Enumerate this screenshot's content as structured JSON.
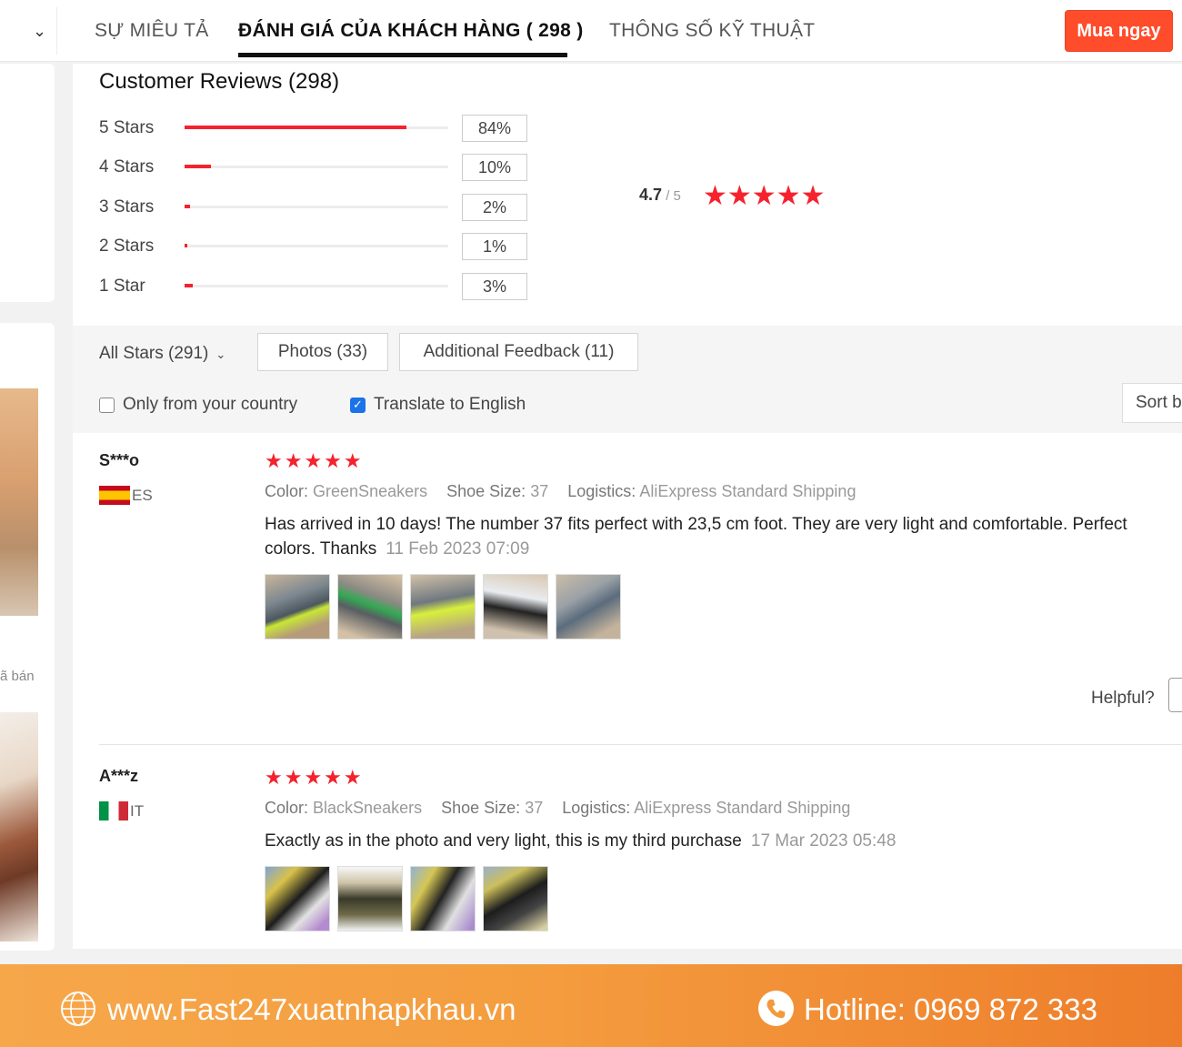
{
  "tabs": [
    {
      "label": "SỰ MIÊU TẢ"
    },
    {
      "label": "ĐÁNH GIÁ CỦA KHÁCH HÀNG  ( 298 )"
    },
    {
      "label": "THÔNG SỐ KỸ THUẬT"
    }
  ],
  "buy_button": "Mua ngay",
  "sidebar": {
    "sold_text": "ã bán"
  },
  "reviews": {
    "title": "Customer Reviews (298)",
    "breakdown": [
      {
        "label": "5 Stars",
        "percent": 84,
        "percent_text": "84%"
      },
      {
        "label": "4 Stars",
        "percent": 10,
        "percent_text": "10%"
      },
      {
        "label": "3 Stars",
        "percent": 2,
        "percent_text": "2%"
      },
      {
        "label": "2 Stars",
        "percent": 1,
        "percent_text": "1%"
      },
      {
        "label": "1 Star",
        "percent": 3,
        "percent_text": "3%"
      }
    ],
    "average": "4.7",
    "average_suffix": " / 5",
    "average_stars": "★★★★★"
  },
  "filters": {
    "all_stars": "All Stars (291)",
    "photos": "Photos (33)",
    "additional": "Additional Feedback (11)",
    "only_country": "Only from your country",
    "only_country_checked": false,
    "translate": "Translate to English",
    "translate_checked": true,
    "sort": "Sort b"
  },
  "review_items": [
    {
      "name": "S***o",
      "country": "ES",
      "stars": "★★★★★",
      "color_label": "Color:",
      "color_value": "GreenSneakers",
      "size_label": "Shoe Size:",
      "size_value": "37",
      "logistics_label": "Logistics:",
      "logistics_value": "AliExpress Standard Shipping",
      "text": "Has arrived in 10 days! The number 37 fits perfect with 23,5 cm foot. They are very light and comfortable. Perfect colors. Thanks",
      "date": "11 Feb 2023 07:09",
      "helpful": "Helpful?"
    },
    {
      "name": "A***z",
      "country": "IT",
      "stars": "★★★★★",
      "color_label": "Color:",
      "color_value": "BlackSneakers",
      "size_label": "Shoe Size:",
      "size_value": "37",
      "logistics_label": "Logistics:",
      "logistics_value": "AliExpress Standard Shipping",
      "text": "Exactly as in the photo and very light, this is my third purchase",
      "date": "17 Mar 2023 05:48"
    }
  ],
  "footer": {
    "website": "www.Fast247xuatnhapkhau.vn",
    "hotline": "Hotline: 0969 872 333"
  },
  "colors": {
    "accent": "#f5222d",
    "buy_button": "#ff4c2b",
    "footer": "#f49d3f"
  }
}
